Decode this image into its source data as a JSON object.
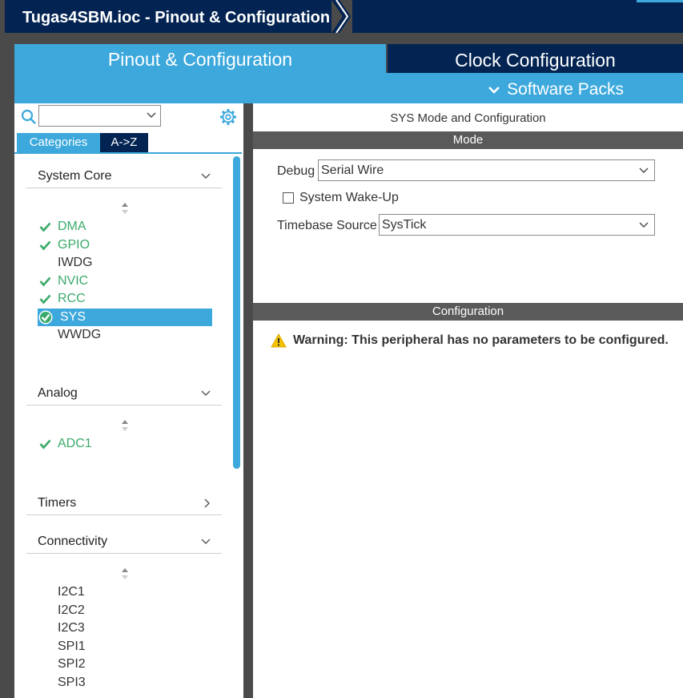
{
  "window": {
    "title": "Tugas4SBM.ioc - Pinout & Configuration"
  },
  "tabs": {
    "pinout_label": "Pinout & Configuration",
    "clock_label": "Clock Configuration",
    "software_packs_label": "Software Packs"
  },
  "left_panel": {
    "search_value": "",
    "view_tabs": {
      "categories": "Categories",
      "az": "A->Z"
    },
    "categories": [
      {
        "name": "System Core",
        "expanded": true,
        "items": [
          {
            "label": "DMA",
            "checked": true
          },
          {
            "label": "GPIO",
            "checked": true
          },
          {
            "label": "IWDG",
            "checked": false
          },
          {
            "label": "NVIC",
            "checked": true
          },
          {
            "label": "RCC",
            "checked": true
          },
          {
            "label": "SYS",
            "checked": true,
            "selected": true
          },
          {
            "label": "WWDG",
            "checked": false
          }
        ]
      },
      {
        "name": "Analog",
        "expanded": true,
        "items": [
          {
            "label": "ADC1",
            "checked": true
          }
        ]
      },
      {
        "name": "Timers",
        "expanded": false,
        "items": []
      },
      {
        "name": "Connectivity",
        "expanded": true,
        "items": [
          {
            "label": "I2C1",
            "checked": false
          },
          {
            "label": "I2C2",
            "checked": false
          },
          {
            "label": "I2C3",
            "checked": false
          },
          {
            "label": "SPI1",
            "checked": false
          },
          {
            "label": "SPI2",
            "checked": false
          },
          {
            "label": "SPI3",
            "checked": false
          }
        ]
      }
    ]
  },
  "mode_panel": {
    "title": "SYS Mode and Configuration",
    "mode_header": "Mode",
    "debug_label": "Debug",
    "debug_value": "Serial Wire",
    "wakeup_label": "System Wake-Up",
    "wakeup_checked": false,
    "timebase_label": "Timebase Source",
    "timebase_value": "SysTick"
  },
  "config_panel": {
    "header": "Configuration",
    "warning": "Warning: This peripheral has no parameters to be configured."
  },
  "colors": {
    "brand_dark": "#032453",
    "brand_light": "#3ca8dc",
    "check_green": "#3aaa6a",
    "warning_yellow": "#f2c200"
  }
}
